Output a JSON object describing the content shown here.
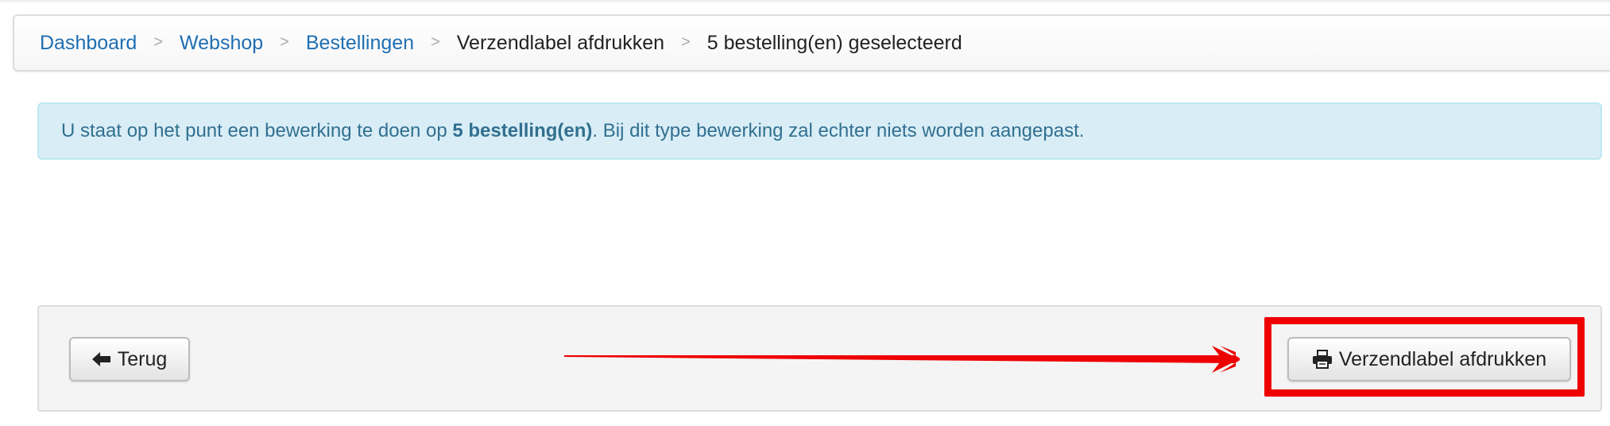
{
  "breadcrumb": {
    "items": [
      {
        "label": "Dashboard",
        "link": true
      },
      {
        "label": "Webshop",
        "link": true
      },
      {
        "label": "Bestellingen",
        "link": true
      },
      {
        "label": "Verzendlabel afdrukken",
        "link": false
      },
      {
        "label": "5 bestelling(en) geselecteerd",
        "link": false
      }
    ],
    "separator": ">"
  },
  "alert": {
    "text_before": "U staat op het punt een bewerking te doen op ",
    "text_bold": "5 bestelling(en)",
    "text_after": ". Bij dit type bewerking zal echter niets worden aangepast."
  },
  "actions": {
    "back_label": "Terug",
    "print_label": "Verzendlabel afdrukken",
    "back_icon": "arrow-left-icon",
    "print_icon": "printer-icon"
  },
  "colors": {
    "link": "#1f6fb2",
    "alert_bg": "#d9edf7",
    "alert_text": "#31708f",
    "annotation": "#ee0000"
  }
}
